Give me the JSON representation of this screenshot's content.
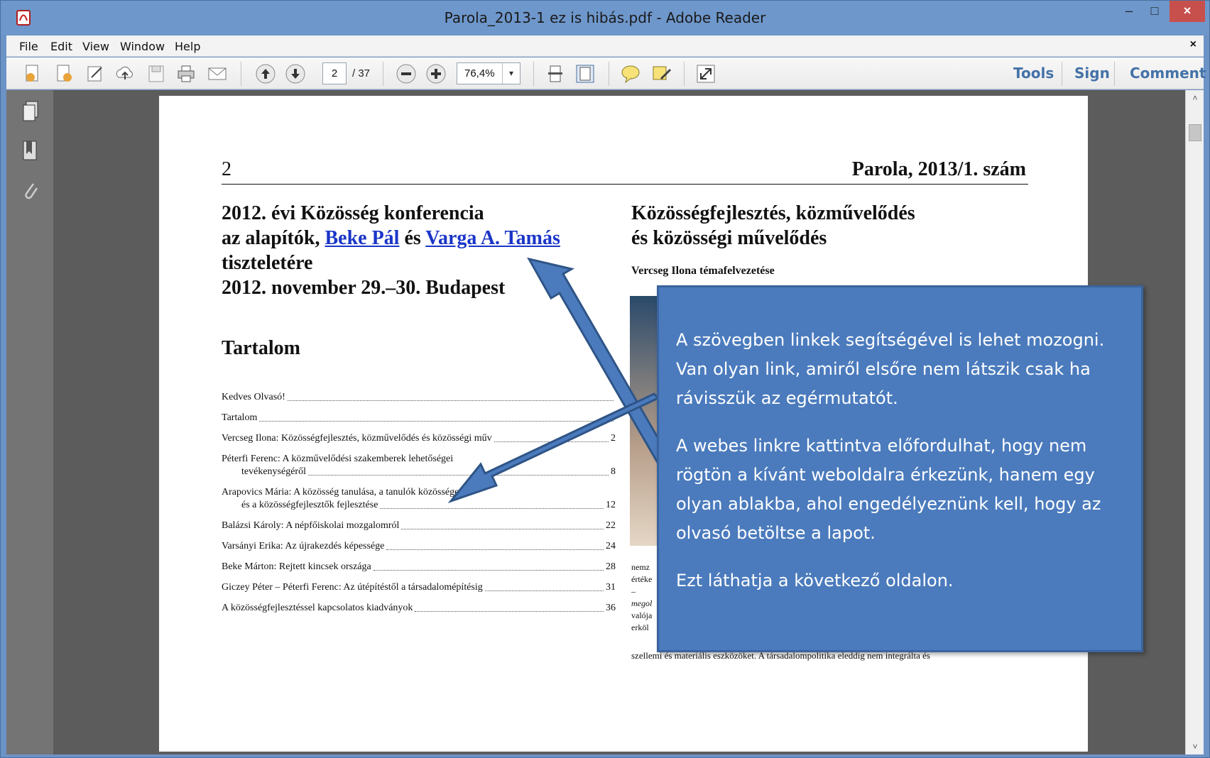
{
  "window": {
    "title": "Parola_2013-1 ez is hibás.pdf - Adobe Reader",
    "min_label": "–",
    "max_label": "□",
    "close_label": "×"
  },
  "menu": {
    "items": [
      {
        "label": "File"
      },
      {
        "label": "Edit"
      },
      {
        "label": "View"
      },
      {
        "label": "Window"
      },
      {
        "label": "Help"
      }
    ],
    "close_label": "×"
  },
  "toolbar": {
    "page_current": "2",
    "page_total": "/ 37",
    "zoom": "76,4%",
    "zoom_dropdown": "▾",
    "links": {
      "tools": "Tools",
      "sign": "Sign",
      "comment": "Comment"
    },
    "icons": [
      "create-pdf-icon",
      "combine-icon",
      "edit-icon",
      "cloud-upload-icon",
      "save-icon",
      "print-icon",
      "email-icon",
      "prev-page-icon",
      "next-page-icon",
      "zoom-out-icon",
      "zoom-in-icon",
      "scroll-mode-icon",
      "fit-page-icon",
      "comment-icon",
      "highlight-icon",
      "fullscreen-icon"
    ]
  },
  "side_panel": {
    "icons": [
      "pages-icon",
      "bookmarks-icon",
      "attachments-icon"
    ]
  },
  "scrollbar": {
    "up": "˄",
    "down": "˅"
  },
  "document": {
    "page_number": "2",
    "journal": "Parola, 2013/1. szám",
    "left_heading": {
      "line1": "2012. évi Közösség konferencia",
      "line2_prefix": "az alapítók, ",
      "link1": "Beke Pál",
      "line2_mid": " és ",
      "link2": "Varga A. Tamás",
      "line3": "tiszteletére",
      "line4": "2012. november 29.–30. Budapest"
    },
    "right_heading": {
      "line1": "Közösségfejlesztés, közművelődés",
      "line2": "és közösségi művelődés"
    },
    "author_line": "Vercseg Ilona témafelvezetése",
    "toc_title": "Tartalom",
    "toc": [
      {
        "title": "Kedves Olvasó!",
        "page": ""
      },
      {
        "title": "Tartalom",
        "page": ""
      },
      {
        "title": "Vercseg Ilona: Közösségfejlesztés, közművelődés  és közösségi műv",
        "page": "2"
      },
      {
        "title": "Péterfi Ferenc: A közművelődési szakemberek lehetőségei",
        "title2": "tevékenységéről",
        "page": "8"
      },
      {
        "title": "Arapovics Mária: A közösség tanulása, a tanulók közössége",
        "title2": "és a közösségfejlesztők fejlesztése",
        "page": "12"
      },
      {
        "title": "Balázsi Károly:  A népfőiskolai mozgalomról",
        "page": "22"
      },
      {
        "title": "Varsányi Erika: Az újrakezdés képessége",
        "page": "24"
      },
      {
        "title": "Beke Márton: Rejtett kincsek országa",
        "page": "28"
      },
      {
        "title": "Giczey Péter – Péterfi Ferenc: Az útépítéstől a társadalomépítésig",
        "page": "31"
      },
      {
        "title": "A közösségfejlesztéssel kapcsolatos kiadványok",
        "page": "36"
      }
    ],
    "right_snippets": [
      "nemz",
      "értéke",
      "   –",
      "megol",
      "valója",
      "erköl"
    ],
    "right_bottom_line": "szellemi és materiális eszközöket. A társadalompolitika eleddig nem integrálta és"
  },
  "callout": {
    "paragraph1": "A szövegben linkek segítségével is lehet mozogni. Van olyan link, amiről elsőre nem látszik csak ha rávisszük az egérmutatót.",
    "paragraph2": "A webes linkre kattintva előfordulhat, hogy nem rögtön a kívánt weboldalra érkezünk, hanem egy olyan ablakba, ahol engedélyeznünk kell, hogy az olvasó betöltse a lapot.",
    "paragraph3": "Ezt láthatja a következő oldalon."
  },
  "colors": {
    "titlebar": "#6e97cb",
    "callout_bg": "#4b7bbd",
    "link": "#1a35c8",
    "toolbar_link": "#4472a8",
    "close_button": "#c7504d"
  }
}
